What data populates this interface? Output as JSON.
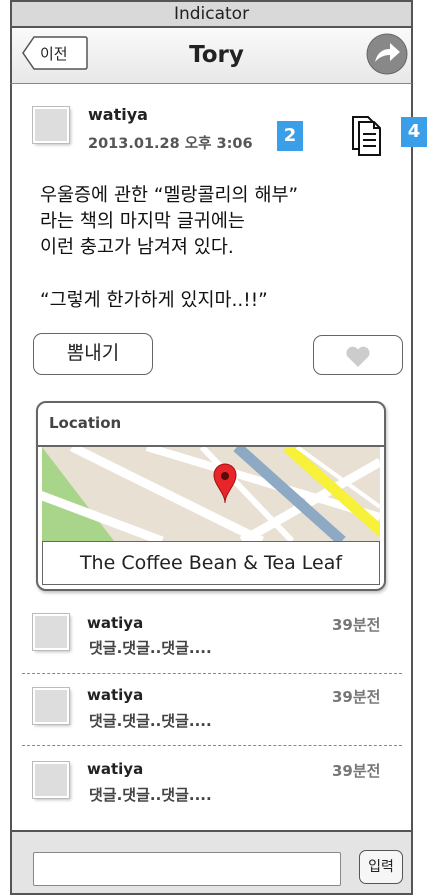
{
  "status_bar": {
    "label": "Indicator"
  },
  "header": {
    "back_label": "이전",
    "title": "Tory",
    "share_icon": "share-arrow-icon"
  },
  "post": {
    "author": "watiya",
    "date": "2013.01.28 오후 3:06",
    "badges": [
      "2",
      "4"
    ],
    "body_lines": [
      "우울증에 관한 “멜랑콜리의 해부”",
      "라는 책의 마지막 글귀에는",
      "이런 충고가 남겨져 있다."
    ],
    "quote": "“그렇게 한가하게 있지마..!!”",
    "show_off_label": "뽐내기",
    "like_icon": "heart-icon",
    "accent_color": "#3b9ee8"
  },
  "location": {
    "heading": "Location",
    "place": "The Coffee Bean & Tea Leaf"
  },
  "comments": [
    {
      "author": "watiya",
      "time": "39분전",
      "text": "댓글.댓글..댓글...."
    },
    {
      "author": "watiya",
      "time": "39분전",
      "text": "댓글.댓글..댓글...."
    },
    {
      "author": "watiya",
      "time": "39분전",
      "text": "댓글.댓글..댓글...."
    }
  ],
  "comment_form": {
    "value": "",
    "placeholder": "",
    "submit_label": "입력"
  }
}
